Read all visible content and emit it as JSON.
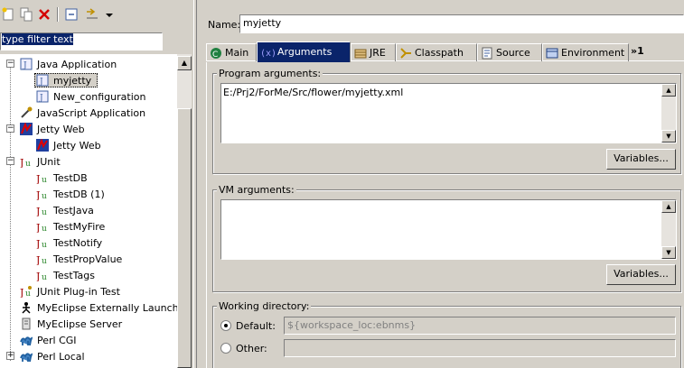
{
  "toolbar": {
    "icons": [
      "new-config-icon",
      "duplicate-icon",
      "delete-icon",
      "collapse-all-icon",
      "filter-icon",
      "dropdown-icon"
    ]
  },
  "filter": {
    "value": "type filter text"
  },
  "tree": {
    "items": [
      {
        "label": "Java Application",
        "icon": "java-app-icon",
        "expanded": true
      },
      {
        "label": "myjetty",
        "icon": "java-file-icon",
        "selected": true
      },
      {
        "label": "New_configuration",
        "icon": "java-file-icon"
      },
      {
        "label": "JavaScript Application",
        "icon": "javascript-icon"
      },
      {
        "label": "Jetty Web",
        "icon": "jetty-icon",
        "expanded": true
      },
      {
        "label": "Jetty Web",
        "icon": "jetty-icon"
      },
      {
        "label": "JUnit",
        "icon": "junit-icon",
        "expanded": true
      },
      {
        "label": "TestDB",
        "icon": "junit-icon"
      },
      {
        "label": "TestDB (1)",
        "icon": "junit-icon"
      },
      {
        "label": "TestJava",
        "icon": "junit-icon"
      },
      {
        "label": "TestMyFire",
        "icon": "junit-icon"
      },
      {
        "label": "TestNotify",
        "icon": "junit-icon"
      },
      {
        "label": "TestPropValue",
        "icon": "junit-icon"
      },
      {
        "label": "TestTags",
        "icon": "junit-icon"
      },
      {
        "label": "JUnit Plug-in Test",
        "icon": "junit-plugin-icon"
      },
      {
        "label": "MyEclipse Externally Launched",
        "icon": "external-launch-icon"
      },
      {
        "label": "MyEclipse Server",
        "icon": "server-icon"
      },
      {
        "label": "Perl CGI",
        "icon": "camel-icon"
      },
      {
        "label": "Perl Local",
        "icon": "camel-icon",
        "expandable": true
      }
    ]
  },
  "name": {
    "label": "Name:",
    "value": "myjetty"
  },
  "tabs": [
    {
      "label": "Main",
      "icon": "main-tab-icon"
    },
    {
      "label": "Arguments",
      "icon": "arguments-icon",
      "active": true
    },
    {
      "label": "JRE",
      "icon": "jre-icon"
    },
    {
      "label": "Classpath",
      "icon": "classpath-icon"
    },
    {
      "label": "Source",
      "icon": "source-icon"
    },
    {
      "label": "Environment",
      "icon": "environment-icon"
    }
  ],
  "tab_overflow": "»1",
  "program_args": {
    "title": "Program arguments:",
    "value": "E:/Prj2/ForMe/Src/flower/myjetty.xml",
    "button": "Variables..."
  },
  "vm_args": {
    "title": "VM arguments:",
    "value": "",
    "button": "Variables..."
  },
  "working_dir": {
    "title": "Working directory:",
    "default_label": "Default:",
    "default_value": "${workspace_loc:ebnms}",
    "other_label": "Other:",
    "other_value": "",
    "selected": "default"
  },
  "colors": {
    "selection": "#0a246a",
    "window": "#d4d0c8"
  }
}
